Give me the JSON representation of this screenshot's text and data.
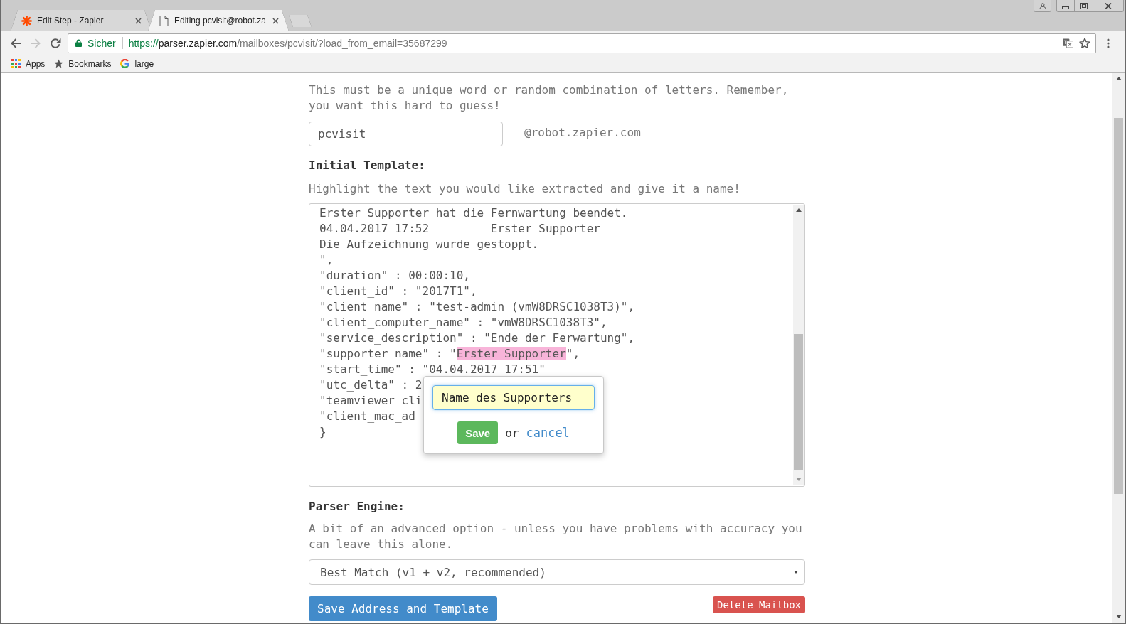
{
  "browser": {
    "tabs": [
      {
        "kind": "logo",
        "title": "Edit Step - Zapier",
        "selected": false
      },
      {
        "kind": "page",
        "title": "Editing pcvisit@robot.za",
        "selected": true
      }
    ],
    "address_bar": {
      "security_label": "Sicher",
      "scheme": "https://",
      "host": "parser.zapier.com",
      "path": "/mailboxes/pcvisit/?load_from_email=35687299"
    },
    "bookmarks": [
      {
        "kind": "apps",
        "label": "Apps"
      },
      {
        "kind": "star",
        "label": "Bookmarks"
      },
      {
        "kind": "google",
        "label": "large"
      }
    ]
  },
  "address_section": {
    "hint": "This must be a unique word or random combination of letters. Remember, you want this hard to guess!",
    "address_field": {
      "value": "pcvisit"
    },
    "domain": "@robot.zapier.com"
  },
  "template_section": {
    "label": "Initial Template:",
    "hint": "Highlight the text you would like extracted and give it a name!",
    "lines": [
      {
        "segments": [
          {
            "text": "Erster Supporter hat die Fernwartung beendet.",
            "highlighted": false
          }
        ]
      },
      {
        "segments": [
          {
            "text": "04.04.2017 17:52         Erster Supporter",
            "highlighted": false
          }
        ]
      },
      {
        "segments": [
          {
            "text": "Die Aufzeichnung wurde gestoppt.",
            "highlighted": false
          }
        ]
      },
      {
        "segments": [
          {
            "text": "\",",
            "highlighted": false
          }
        ]
      },
      {
        "segments": [
          {
            "text": "\"duration\" : 00:00:10,",
            "highlighted": false
          }
        ]
      },
      {
        "segments": [
          {
            "text": "\"client_id\" : \"2017T1\",",
            "highlighted": false
          }
        ]
      },
      {
        "segments": [
          {
            "text": "\"client_name\" : \"test-admin (vmW8DRSC1038T3)\",",
            "highlighted": false
          }
        ]
      },
      {
        "segments": [
          {
            "text": "\"client_computer_name\" : \"vmW8DRSC1038T3\",",
            "highlighted": false
          }
        ]
      },
      {
        "segments": [
          {
            "text": "\"service_description\" : \"Ende der Ferwartung\",",
            "highlighted": false
          }
        ]
      },
      {
        "segments": [
          {
            "text": "\"supporter_name\" : \"",
            "highlighted": false
          },
          {
            "text": "Erster Supporter",
            "highlighted": true
          },
          {
            "text": "\",",
            "highlighted": false
          }
        ]
      },
      {
        "segments": [
          {
            "text": "\"start_time\" : \"04.04.2017 17:51\"",
            "highlighted": false
          }
        ]
      },
      {
        "segments": [
          {
            "text": "\"utc_delta\" : 2",
            "highlighted": false
          }
        ]
      },
      {
        "segments": [
          {
            "text": "\"teamviewer_cli",
            "highlighted": false
          }
        ]
      },
      {
        "segments": [
          {
            "text": "\"client_mac_ad",
            "highlighted": false
          }
        ]
      },
      {
        "segments": [
          {
            "text": "}",
            "highlighted": false
          }
        ]
      }
    ],
    "name_popover": {
      "name_field": {
        "value": "Name des Supporters"
      },
      "save_button": "Save",
      "separator": "or",
      "cancel_link": "cancel"
    }
  },
  "parser_section": {
    "label": "Parser Engine:",
    "hint": "A bit of an advanced option - unless you have problems with accuracy you can leave this alone.",
    "engine_select": {
      "value": "Best Match (v1 + v2, recommended)"
    }
  },
  "actions": [
    {
      "kind": "primary",
      "label": "Save Address and Template"
    },
    {
      "kind": "danger",
      "label": "Delete Mailbox"
    }
  ]
}
